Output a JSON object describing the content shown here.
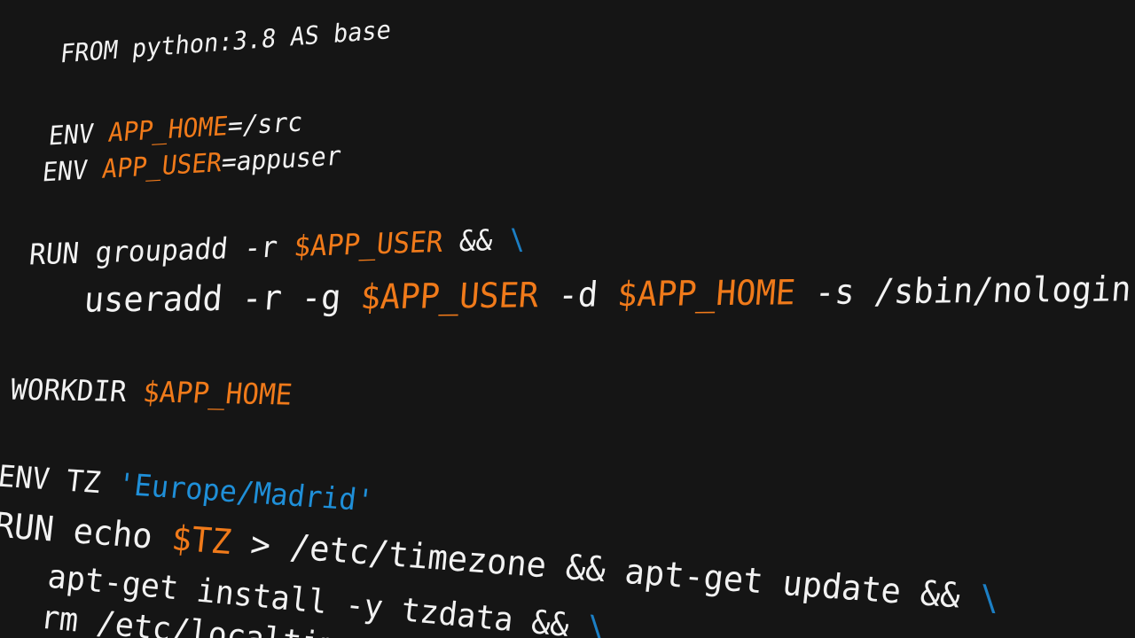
{
  "colors": {
    "background": "#151515",
    "text": "#f2f2f2",
    "variable": "#f07a1a",
    "string": "#1f8fd8",
    "continuation": "#1c7fc4"
  },
  "lines": [
    {
      "name": "line-from",
      "tokens": [
        {
          "t": "FROM python:3.8 AS base",
          "k": "plain"
        }
      ]
    },
    {
      "name": "line-env-app-home",
      "tokens": [
        {
          "t": "ENV ",
          "k": "plain"
        },
        {
          "t": "APP_HOME",
          "k": "var"
        },
        {
          "t": "=/src",
          "k": "plain"
        }
      ]
    },
    {
      "name": "line-env-app-user",
      "tokens": [
        {
          "t": "ENV ",
          "k": "plain"
        },
        {
          "t": "APP_USER",
          "k": "var"
        },
        {
          "t": "=appuser",
          "k": "plain"
        }
      ]
    },
    {
      "name": "line-run-groupadd",
      "tokens": [
        {
          "t": "RUN groupadd -r ",
          "k": "plain"
        },
        {
          "t": "$APP_USER",
          "k": "var"
        },
        {
          "t": " && ",
          "k": "plain"
        },
        {
          "t": "\\",
          "k": "cont"
        }
      ]
    },
    {
      "name": "line-useradd",
      "tokens": [
        {
          "t": "useradd -r -g ",
          "k": "plain"
        },
        {
          "t": "$APP_USER",
          "k": "var"
        },
        {
          "t": " -d ",
          "k": "plain"
        },
        {
          "t": "$APP_HOME",
          "k": "var"
        },
        {
          "t": " -s /sbin/nologin",
          "k": "plain"
        }
      ]
    },
    {
      "name": "line-workdir",
      "tokens": [
        {
          "t": "WORKDIR ",
          "k": "plain"
        },
        {
          "t": "$APP_HOME",
          "k": "var"
        }
      ]
    },
    {
      "name": "line-env-tz",
      "tokens": [
        {
          "t": "ENV TZ ",
          "k": "plain"
        },
        {
          "t": "'Europe/Madrid'",
          "k": "str"
        }
      ]
    },
    {
      "name": "line-run-echo",
      "tokens": [
        {
          "t": "RUN echo ",
          "k": "plain"
        },
        {
          "t": "$TZ",
          "k": "var"
        },
        {
          "t": " > /etc/timezone && apt-get update && ",
          "k": "plain"
        },
        {
          "t": "\\",
          "k": "cont"
        }
      ]
    },
    {
      "name": "line-apt-install",
      "tokens": [
        {
          "t": "apt-get install -y tzdata && ",
          "k": "plain"
        },
        {
          "t": "\\",
          "k": "cont"
        }
      ]
    },
    {
      "name": "line-rm-localtime",
      "tokens": [
        {
          "t": "rm /etc/localtime",
          "k": "plain"
        }
      ]
    }
  ]
}
